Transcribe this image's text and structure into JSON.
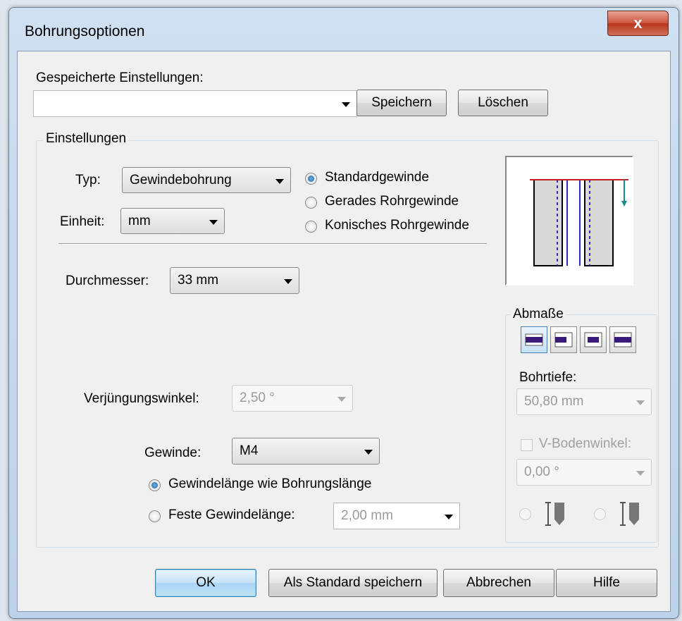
{
  "window": {
    "title": "Bohrungsoptionen",
    "close_label": "x"
  },
  "saved": {
    "label": "Gespeicherte Einstellungen:",
    "value": "",
    "save_button": "Speichern",
    "delete_button": "Löschen"
  },
  "settings": {
    "group_title": "Einstellungen",
    "type_label": "Typ:",
    "type_value": "Gewindebohrung",
    "unit_label": "Einheit:",
    "unit_value": "mm",
    "thread_kinds": [
      "Standardgewinde",
      "Gerades Rohrgewinde",
      "Konisches Rohrgewinde"
    ],
    "diameter_label": "Durchmesser:",
    "diameter_value": "33 mm",
    "taper_label": "Verjüngungswinkel:",
    "taper_value": "2,50 °",
    "thread_label": "Gewinde:",
    "thread_value": "M4",
    "length_option_1": "Gewindelänge wie Bohrungslänge",
    "length_option_2": "Feste Gewindelänge:",
    "fixed_length_value": "2,00 mm"
  },
  "dimensions": {
    "group_title": "Abmaße",
    "depth_label": "Bohrtiefe:",
    "depth_value": "50,80 mm",
    "v_bottom_label": "V-Bodenwinkel:",
    "v_bottom_value": "0,00 °"
  },
  "footer": {
    "ok": "OK",
    "save_default": "Als Standard speichern",
    "cancel": "Abbrechen",
    "help": "Hilfe"
  },
  "colors": {
    "accent": "#3c7fb1",
    "close": "#c9553e",
    "dim_icon": "#3a1a78"
  }
}
